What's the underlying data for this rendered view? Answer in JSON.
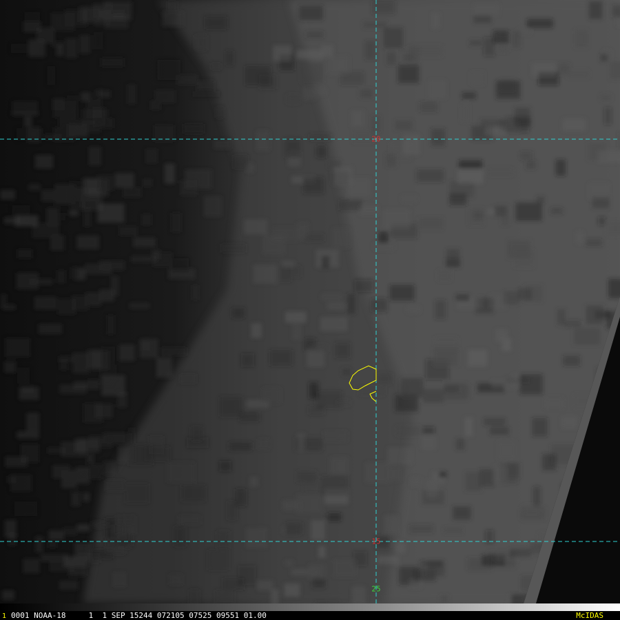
{
  "image": {
    "description_colors": {
      "grid": "#2fd3d3",
      "lat_label": "#d03030",
      "lon_label": "#3ad83a",
      "coast": "#ffff00",
      "background": "#000000"
    },
    "grid_labels": {
      "lat_top": "20",
      "lat_bottom": "15",
      "lon_bottom": "25"
    }
  },
  "status": {
    "frame": "1",
    "line": "0001 NOAA-18     1  1 SEP 15244 072105 07525 09551 01.00",
    "brand": "McIDAS"
  }
}
